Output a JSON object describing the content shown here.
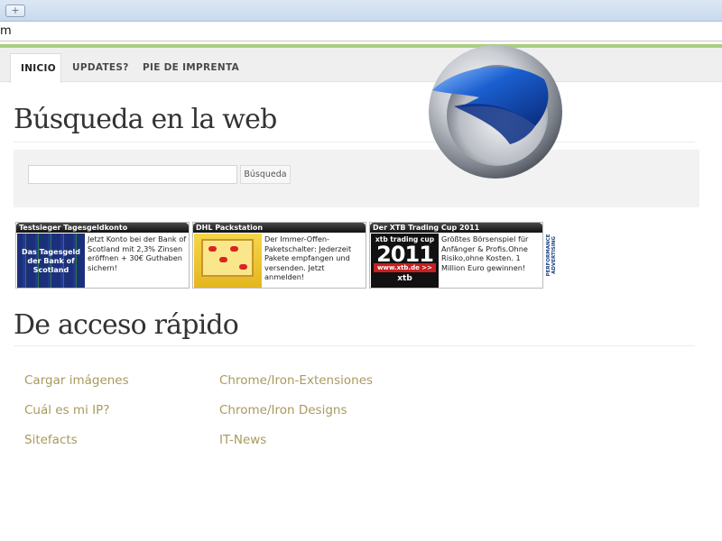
{
  "browser": {
    "new_tab_icon": "new-tab-plus-icon",
    "address": "m"
  },
  "nav": {
    "tabs": [
      {
        "label": "INICIO",
        "active": true
      },
      {
        "label": "UPDATES?",
        "active": false
      },
      {
        "label": "PIE DE IMPRENTA",
        "active": false
      }
    ]
  },
  "search": {
    "heading": "Búsqueda en la web",
    "input_value": "",
    "button_label": "Búsqueda"
  },
  "ads": [
    {
      "title": "Testsieger Tagesgeldkonto",
      "image_text": "Das Tagesgeld der Bank of Scotland",
      "text": "Jetzt Konto bei der Bank of Scotland mit 2,3% Zinsen eröffnen + 30€ Guthaben sichern!"
    },
    {
      "title": "DHL Packstation",
      "text": "Der Immer-Offen-Paketschalter: Jederzeit Pakete empfangen und versenden. Jetzt anmelden!"
    },
    {
      "title": "Der XTB Trading Cup 2011",
      "image_top": "xtb trading cup",
      "image_year": "2011",
      "image_url": "www.xtb.de >>",
      "image_logo": "xtb",
      "text": "Größtes Börsenspiel für Anfänger & Profis.Ohne Risiko,ohne Kosten. 1 Million Euro gewinnen!"
    }
  ],
  "ad_network": "PERFORMANCE ADVERTISING",
  "quick": {
    "heading": "De acceso rápido",
    "left": [
      "Cargar imágenes",
      "Cuál es mi IP?",
      "Sitefacts"
    ],
    "right": [
      "Chrome/Iron-Extensiones",
      "Chrome/Iron Designs",
      "IT-News"
    ]
  },
  "colors": {
    "accent_green": "#a9d07d",
    "link": "#a89a5e",
    "logo_blue": "#1a5fd0"
  }
}
